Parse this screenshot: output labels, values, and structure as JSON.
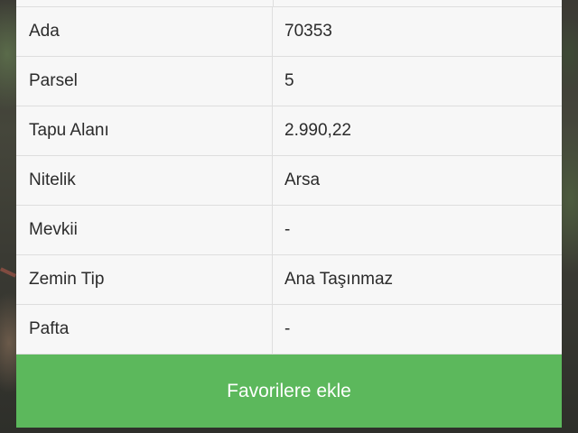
{
  "parcel_info": {
    "rows": [
      {
        "key": "Ada",
        "value": "70353"
      },
      {
        "key": "Parsel",
        "value": "5"
      },
      {
        "key": "Tapu Alanı",
        "value": "2.990,22"
      },
      {
        "key": "Nitelik",
        "value": "Arsa"
      },
      {
        "key": "Mevkii",
        "value": "-"
      },
      {
        "key": "Zemin Tip",
        "value": "Ana Taşınmaz"
      },
      {
        "key": "Pafta",
        "value": "-"
      }
    ]
  },
  "actions": {
    "add_favorite_label": "Favorilere ekle"
  },
  "colors": {
    "button_green": "#5cb85c",
    "row_background": "#f7f7f7",
    "divider": "#dedede"
  }
}
